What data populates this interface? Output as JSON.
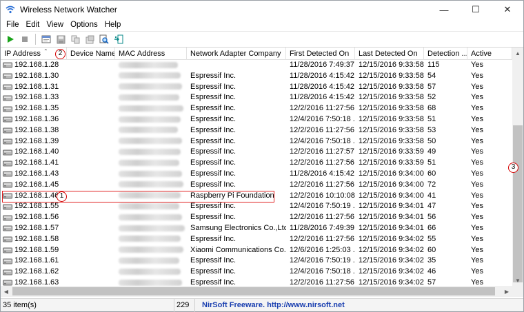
{
  "window": {
    "title": "Wireless Network Watcher",
    "minimize": "—",
    "maximize": "☐",
    "close": "✕"
  },
  "menu": [
    "File",
    "Edit",
    "View",
    "Options",
    "Help"
  ],
  "columns": [
    {
      "label": "IP Address",
      "width": 96
    },
    {
      "label": "Device Name",
      "width": 70
    },
    {
      "label": "MAC Address",
      "width": 104
    },
    {
      "label": "Network Adapter Company",
      "width": 144
    },
    {
      "label": "First Detected On",
      "width": 100
    },
    {
      "label": "Last Detected On",
      "width": 100
    },
    {
      "label": "Detection ...",
      "width": 63
    },
    {
      "label": "Active",
      "width": 65
    }
  ],
  "sort_indicator": "⌃",
  "rows": [
    {
      "ip": "192.168.1.28",
      "company": "",
      "first": "11/28/2016 7:49:37...",
      "last": "12/15/2016 9:33:58...",
      "count": "115",
      "active": "Yes"
    },
    {
      "ip": "192.168.1.30",
      "company": "Espressif Inc.",
      "first": "11/28/2016 4:15:42...",
      "last": "12/15/2016 9:33:58...",
      "count": "54",
      "active": "Yes"
    },
    {
      "ip": "192.168.1.31",
      "company": "Espressif Inc.",
      "first": "11/28/2016 4:15:42...",
      "last": "12/15/2016 9:33:58...",
      "count": "57",
      "active": "Yes"
    },
    {
      "ip": "192.168.1.33",
      "company": "Espressif Inc.",
      "first": "11/28/2016 4:15:42...",
      "last": "12/15/2016 9:33:58...",
      "count": "52",
      "active": "Yes"
    },
    {
      "ip": "192.168.1.35",
      "company": "Espressif Inc.",
      "first": "12/2/2016 11:27:56...",
      "last": "12/15/2016 9:33:58...",
      "count": "68",
      "active": "Yes"
    },
    {
      "ip": "192.168.1.36",
      "company": "Espressif Inc.",
      "first": "12/4/2016 7:50:18 ...",
      "last": "12/15/2016 9:33:58...",
      "count": "51",
      "active": "Yes"
    },
    {
      "ip": "192.168.1.38",
      "company": "Espressif Inc.",
      "first": "12/2/2016 11:27:56...",
      "last": "12/15/2016 9:33:58...",
      "count": "53",
      "active": "Yes"
    },
    {
      "ip": "192.168.1.39",
      "company": "Espressif Inc.",
      "first": "12/4/2016 7:50:18 ...",
      "last": "12/15/2016 9:33:58...",
      "count": "50",
      "active": "Yes"
    },
    {
      "ip": "192.168.1.40",
      "company": "Espressif Inc.",
      "first": "12/2/2016 11:27:57...",
      "last": "12/15/2016 9:33:59...",
      "count": "49",
      "active": "Yes"
    },
    {
      "ip": "192.168.1.41",
      "company": "Espressif Inc.",
      "first": "12/2/2016 11:27:56...",
      "last": "12/15/2016 9:33:59...",
      "count": "51",
      "active": "Yes"
    },
    {
      "ip": "192.168.1.43",
      "company": "Espressif Inc.",
      "first": "11/28/2016 4:15:42...",
      "last": "12/15/2016 9:34:00...",
      "count": "60",
      "active": "Yes"
    },
    {
      "ip": "192.168.1.45",
      "company": "Espressif Inc.",
      "first": "12/2/2016 11:27:56...",
      "last": "12/15/2016 9:34:00...",
      "count": "72",
      "active": "Yes"
    },
    {
      "ip": "192.168.1.46",
      "company": "Raspberry Pi Foundation",
      "first": "12/2/2016 10:10:08...",
      "last": "12/15/2016 9:34:00...",
      "count": "41",
      "active": "Yes"
    },
    {
      "ip": "192.168.1.55",
      "company": "Espressif Inc.",
      "first": "12/4/2016 7:50:19 ...",
      "last": "12/15/2016 9:34:01...",
      "count": "47",
      "active": "Yes"
    },
    {
      "ip": "192.168.1.56",
      "company": "Espressif Inc.",
      "first": "12/2/2016 11:27:56...",
      "last": "12/15/2016 9:34:01...",
      "count": "56",
      "active": "Yes"
    },
    {
      "ip": "192.168.1.57",
      "company": "Samsung Electronics Co.,Ltd",
      "first": "11/28/2016 7:49:39...",
      "last": "12/15/2016 9:34:01...",
      "count": "66",
      "active": "Yes"
    },
    {
      "ip": "192.168.1.58",
      "company": "Espressif Inc.",
      "first": "12/2/2016 11:27:56...",
      "last": "12/15/2016 9:34:02...",
      "count": "55",
      "active": "Yes"
    },
    {
      "ip": "192.168.1.59",
      "company": "Xiaomi Communications Co...",
      "first": "12/6/2016 1:25:03 ...",
      "last": "12/15/2016 9:34:02...",
      "count": "60",
      "active": "Yes"
    },
    {
      "ip": "192.168.1.61",
      "company": "Espressif Inc.",
      "first": "12/4/2016 7:50:19 ...",
      "last": "12/15/2016 9:34:02...",
      "count": "35",
      "active": "Yes"
    },
    {
      "ip": "192.168.1.62",
      "company": "Espressif Inc.",
      "first": "12/4/2016 7:50:18 ...",
      "last": "12/15/2016 9:34:02...",
      "count": "46",
      "active": "Yes"
    },
    {
      "ip": "192.168.1.63",
      "company": "Espressif Inc.",
      "first": "12/2/2016 11:27:56...",
      "last": "12/15/2016 9:34:02...",
      "count": "57",
      "active": "Yes"
    }
  ],
  "status": {
    "items": "35 item(s)",
    "count": "229",
    "link": "NirSoft Freeware.  http://www.nirsoft.net"
  },
  "callouts": [
    "1",
    "2",
    "3"
  ],
  "icons": {
    "toolbar": [
      "play-icon",
      "stop-icon",
      "window-icon",
      "save-icon",
      "copy-icon",
      "html-report-icon",
      "find-icon",
      "exit-icon"
    ],
    "row": "computer-icon"
  },
  "colors": {
    "play": "#1aa31a",
    "callout": "#d40000",
    "link": "#1a3fb0"
  }
}
